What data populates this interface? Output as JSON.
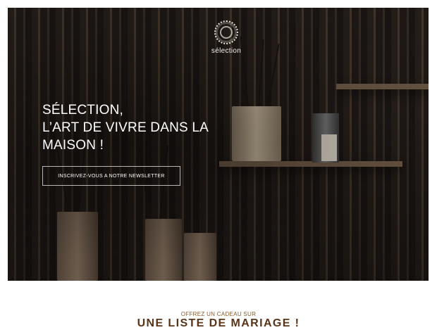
{
  "brand": {
    "name": "sélection",
    "icon": "dotted-circle-logo-icon"
  },
  "hero": {
    "headline": [
      "SÉLECTION,",
      "L’ART DE VIVRE DANS LA",
      "MAISON !"
    ],
    "newsletter_label": "INSCRIVEZ-VOUS A NOTRE NEWSLETTER"
  },
  "promo": {
    "subtitle": "OFFREZ UN CADEAU SUR",
    "title": "UNE LISTE DE MARIAGE !"
  },
  "colors": {
    "accent": "#8a5a2b",
    "title": "#5a3418",
    "hero_text": "#ffffff"
  }
}
